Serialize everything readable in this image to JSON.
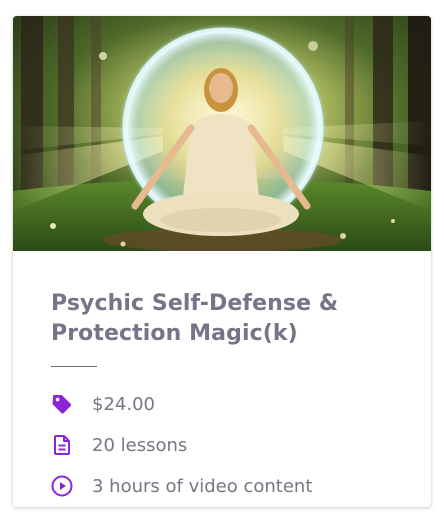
{
  "course": {
    "title": "Psychic Self-Defense & Protection Magic(k)",
    "image_alt": "Woman meditating in a glowing protective orb in a sunlit forest",
    "price": "$24.00",
    "lessons": "20 lessons",
    "video": "3 hours of video content"
  },
  "icons": {
    "price": "price-tag-icon",
    "lessons": "document-icon",
    "video": "play-circle-icon"
  },
  "colors": {
    "accent": "#8e24d8",
    "title": "#767487",
    "meta_text": "#777783"
  }
}
